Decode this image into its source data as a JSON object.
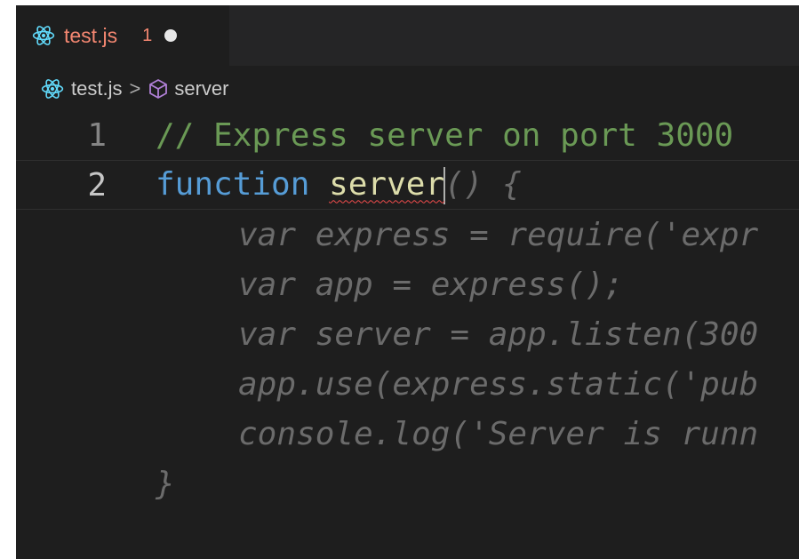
{
  "tab": {
    "file_name": "test.js",
    "problem_count": "1",
    "icon": "react-icon"
  },
  "breadcrumb": {
    "file": "test.js",
    "separator": ">",
    "symbol": "server",
    "symbol_icon": "cube-icon"
  },
  "editor": {
    "lines": [
      {
        "number": "1",
        "text": "// Express server on port 3000"
      },
      {
        "number": "2",
        "keyword": "function",
        "name": "server",
        "rest": "() {"
      }
    ],
    "ghost_suggestion": [
      "var express = require('expr",
      "var app = express();",
      "var server = app.listen(300",
      "app.use(express.static('pub",
      "console.log('Server is runn",
      "}"
    ]
  },
  "colors": {
    "editor_background": "#1e1e1e",
    "tab_error": "#f48771",
    "comment": "#6a9955",
    "keyword": "#569cd6",
    "function_name": "#dcdcaa",
    "ghost_text": "#6b6b6b",
    "squiggle": "#f14c4c"
  }
}
